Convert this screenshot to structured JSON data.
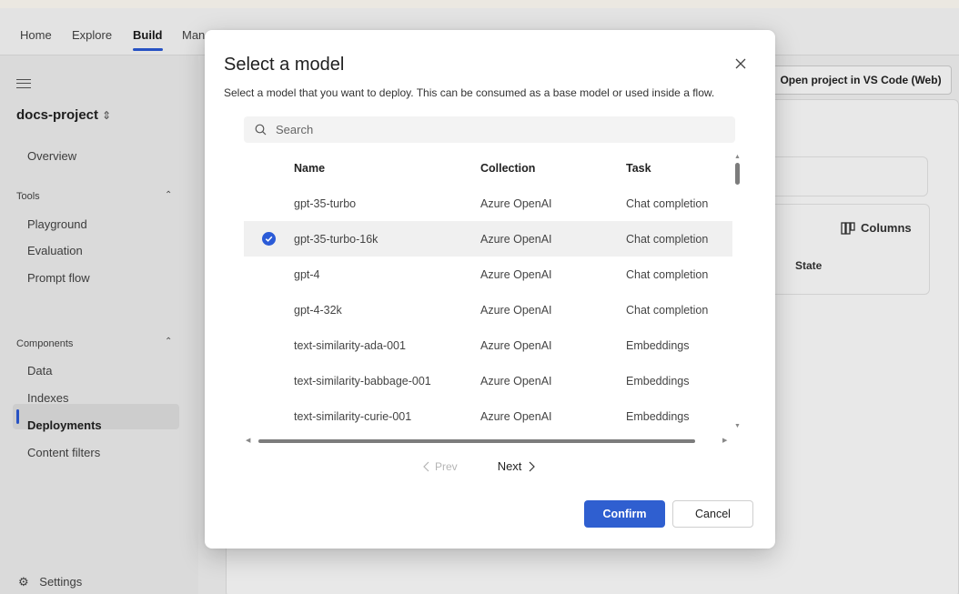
{
  "topnav": {
    "tabs": [
      {
        "label": "Home"
      },
      {
        "label": "Explore"
      },
      {
        "label": "Build"
      },
      {
        "label": "Man"
      }
    ]
  },
  "sidebar": {
    "project_name": "docs-project",
    "overview": "Overview",
    "tools_heading": "Tools",
    "tools_items": [
      "Playground",
      "Evaluation",
      "Prompt flow"
    ],
    "components_heading": "Components",
    "components_items": [
      "Data",
      "Indexes",
      "Deployments",
      "Content filters"
    ],
    "settings": "Settings"
  },
  "background": {
    "vs_code_button": "Open project in VS Code (Web)",
    "columns_button": "Columns",
    "state_header": "State"
  },
  "modal": {
    "title": "Select a model",
    "description": "Select a model that you want to deploy. This can be consumed as a base model or used inside a flow.",
    "search_placeholder": "Search",
    "columns": {
      "name": "Name",
      "collection": "Collection",
      "task": "Task"
    },
    "rows": [
      {
        "name": "gpt-35-turbo",
        "collection": "Azure OpenAI",
        "task": "Chat completion",
        "selected": false
      },
      {
        "name": "gpt-35-turbo-16k",
        "collection": "Azure OpenAI",
        "task": "Chat completion",
        "selected": true
      },
      {
        "name": "gpt-4",
        "collection": "Azure OpenAI",
        "task": "Chat completion",
        "selected": false
      },
      {
        "name": "gpt-4-32k",
        "collection": "Azure OpenAI",
        "task": "Chat completion",
        "selected": false
      },
      {
        "name": "text-similarity-ada-001",
        "collection": "Azure OpenAI",
        "task": "Embeddings",
        "selected": false
      },
      {
        "name": "text-similarity-babbage-001",
        "collection": "Azure OpenAI",
        "task": "Embeddings",
        "selected": false
      },
      {
        "name": "text-similarity-curie-001",
        "collection": "Azure OpenAI",
        "task": "Embeddings",
        "selected": false
      }
    ],
    "pager": {
      "prev": "Prev",
      "next": "Next"
    },
    "confirm": "Confirm",
    "cancel": "Cancel"
  },
  "colors": {
    "accent": "#2b5bd7",
    "primary_button": "#2f5fd0"
  }
}
